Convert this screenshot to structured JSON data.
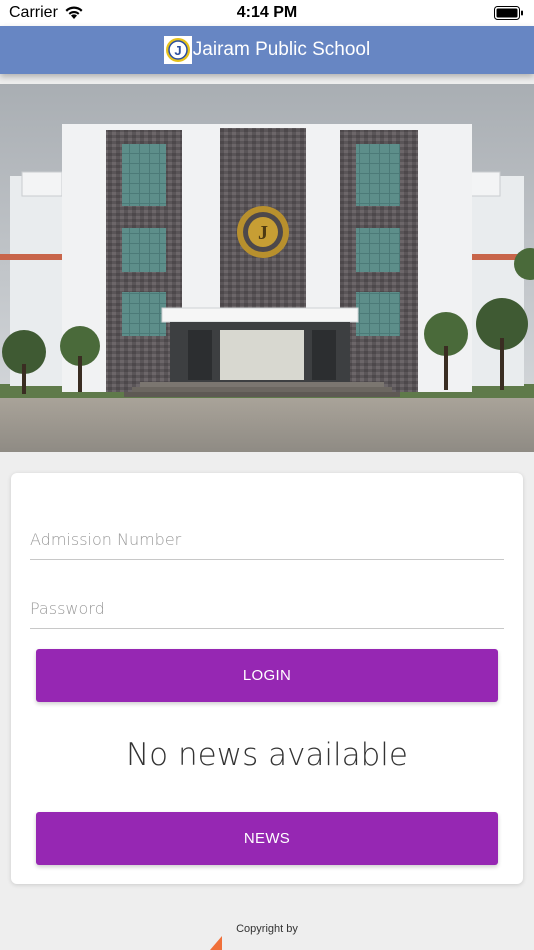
{
  "status_bar": {
    "carrier": "Carrier",
    "time": "4:14 PM"
  },
  "app_bar": {
    "logo_letter": "J",
    "title": "Jairam Public School",
    "background": "#6786c3"
  },
  "hero": {
    "emblem_letter": "J"
  },
  "login_form": {
    "admission_placeholder": "Admission Number",
    "password_placeholder": "Password",
    "login_label": "LOGIN",
    "news_message": "No news available",
    "news_label": "NEWS",
    "button_color": "#9627b3"
  },
  "footer": {
    "copyright_label": "Copyright by"
  }
}
